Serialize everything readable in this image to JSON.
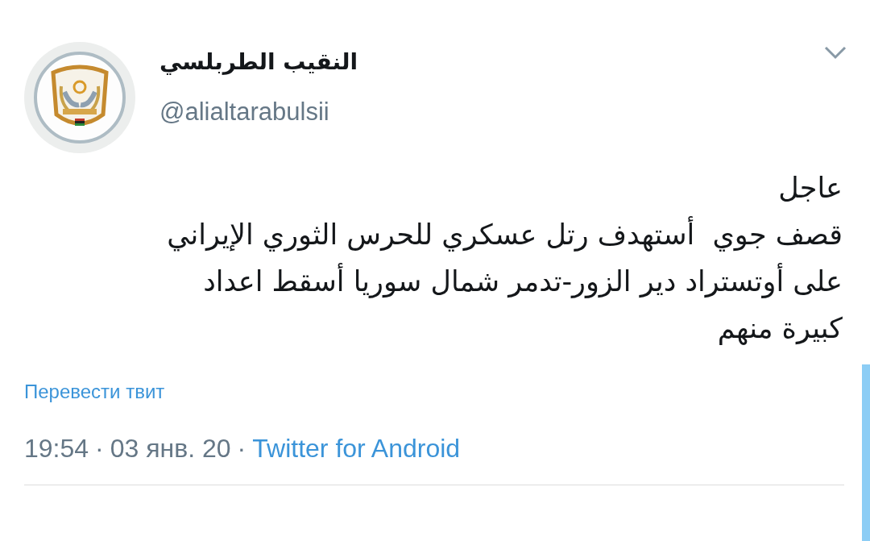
{
  "author": {
    "name": "النقيب الطربلسي",
    "handle": "@alialtarabulsii"
  },
  "tweet": {
    "text": "عاجل\nقصف جوي  أستهدف رتل عسكري للحرس الثوري الإيراني\nعلى أوتستراد دير الزور-تدمر شمال سوريا أسقط اعداد\nكبيرة منهم"
  },
  "translate_link": "Перевести твит",
  "meta": {
    "time": "19:54",
    "separator_1": "·",
    "date": "03 янв. 20",
    "separator_2": "·",
    "source": "Twitter for Android"
  }
}
